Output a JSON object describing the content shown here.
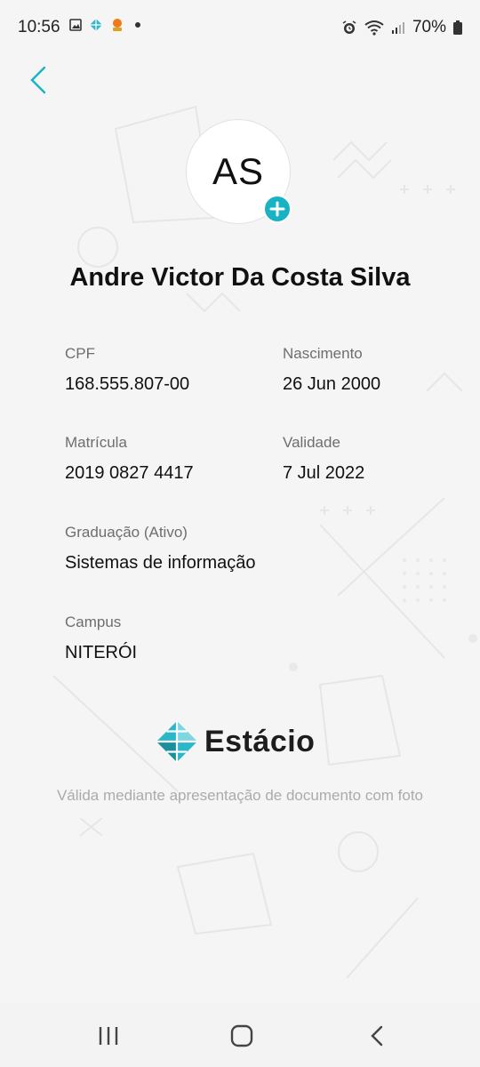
{
  "status_bar": {
    "time": "10:56",
    "battery": "70%",
    "icons": [
      "gallery-icon",
      "app-diamond-icon",
      "app-orange-icon",
      "dot-icon",
      "alarm-icon",
      "wifi-icon",
      "signal-icon",
      "battery-icon"
    ]
  },
  "header": {
    "back_icon": "chevron-left-icon"
  },
  "profile": {
    "initials": "AS",
    "add_photo_icon": "plus-icon",
    "name": "Andre Victor Da Costa Silva"
  },
  "fields": {
    "cpf": {
      "label": "CPF",
      "value": "168.555.807-00"
    },
    "nascimento": {
      "label": "Nascimento",
      "value": "26 Jun 2000"
    },
    "matricula": {
      "label": "Matrícula",
      "value": "2019 0827 4417"
    },
    "validade": {
      "label": "Validade",
      "value": "7 Jul 2022"
    },
    "graduacao": {
      "label": "Graduação (Ativo)",
      "value": "Sistemas de informação"
    },
    "campus": {
      "label": "Campus",
      "value": "NITERÓI"
    }
  },
  "logo": {
    "text": "Estácio"
  },
  "disclaimer": "Válida mediante apresentação de documento com foto",
  "nav": {
    "recent_icon": "recent-apps-icon",
    "home_icon": "home-icon",
    "back_icon": "back-icon"
  },
  "colors": {
    "accent": "#17b3c4",
    "background": "#f5f5f5",
    "text": "#111111",
    "muted": "#6e6e6e"
  }
}
